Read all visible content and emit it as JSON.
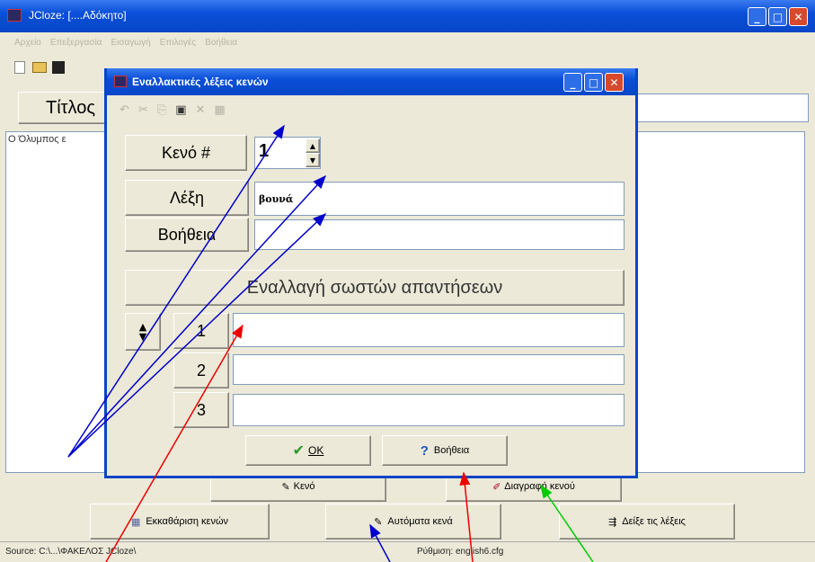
{
  "main_window": {
    "title": "JCloze: [....Αδόκητο]",
    "menu": [
      "Αρχείο",
      "Επεξεργασία",
      "Εισαγωγή",
      "Επιλογές",
      "Βοήθεια"
    ],
    "title_field_label": "Τίτλος",
    "text_preview": "Ο Όλυμπος ε",
    "buttons": {
      "gap": "Κενό",
      "delete_gap": "Διαγραφή κενού",
      "clear_gaps": "Εκκαθάριση κενών",
      "auto_gap": "Αυτόματα κενά",
      "show_words": "Δείξε τις λέξεις"
    },
    "status": {
      "source": "Source: C:\\...\\ΦΑΚΕΛΟΣ JCloze\\",
      "config": "Ρύθμιση: english6.cfg"
    }
  },
  "dialog": {
    "title": "Εναλλακτικές λέξεις κενών",
    "gap_label": "Κενό #",
    "gap_number": "1",
    "word_label": "Λέξη",
    "word_value": "βουνά",
    "hint_label": "Βοήθεια",
    "hint_value": "",
    "alt_header": "Εναλλαγή σωστών απαντήσεων",
    "alternatives": [
      {
        "num": "1",
        "value": ""
      },
      {
        "num": "2",
        "value": ""
      },
      {
        "num": "3",
        "value": ""
      }
    ],
    "ok_label": "OK",
    "help_label": "Βοήθεια"
  },
  "annotation_colors": {
    "blue": "#0000cc",
    "red": "#ee0000",
    "green": "#00cc00"
  },
  "icons": [
    "app-icon",
    "new-icon",
    "open-icon",
    "save-icon",
    "undo-icon",
    "cut-icon",
    "copy-icon",
    "paste-icon",
    "delete-icon",
    "grid-icon",
    "checkmark-icon",
    "help-icon",
    "spin-up-icon",
    "spin-down-icon",
    "move-updown-icon",
    "gap-pen-icon",
    "eraser-icon",
    "clear-icon",
    "auto-gap-icon",
    "show-words-icon"
  ]
}
